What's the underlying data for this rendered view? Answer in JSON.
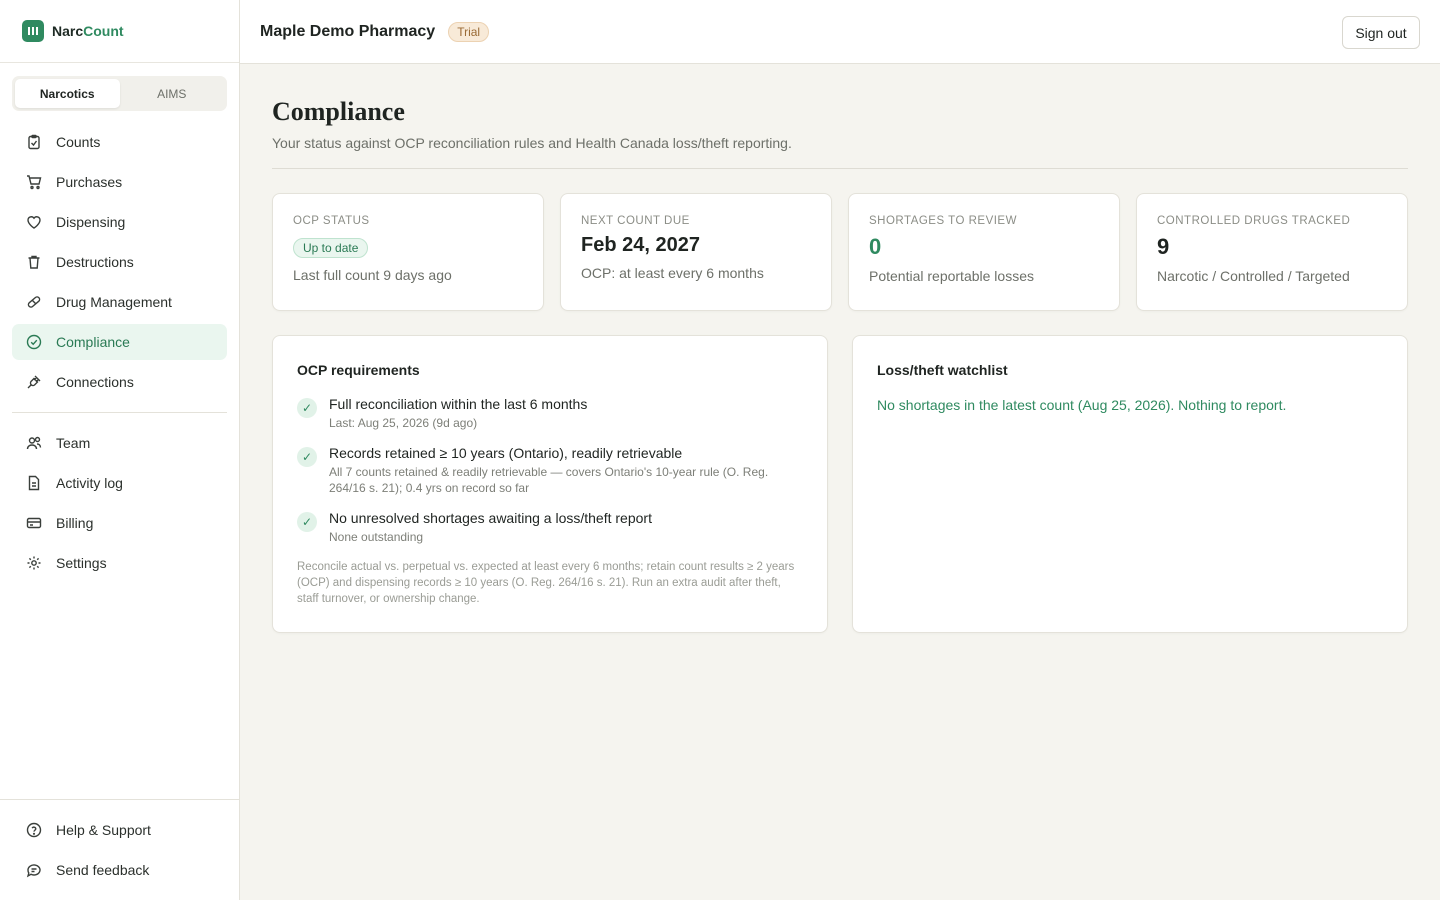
{
  "brand": {
    "name_part1": "Narc",
    "name_part2": "Count"
  },
  "sidebar": {
    "segments": [
      {
        "label": "Narcotics",
        "active": true
      },
      {
        "label": "AIMS",
        "active": false
      }
    ],
    "items": [
      {
        "label": "Counts",
        "icon": "clipboard-check-icon"
      },
      {
        "label": "Purchases",
        "icon": "cart-icon"
      },
      {
        "label": "Dispensing",
        "icon": "heart-icon"
      },
      {
        "label": "Destructions",
        "icon": "trash-icon"
      },
      {
        "label": "Drug Management",
        "icon": "pill-icon"
      },
      {
        "label": "Compliance",
        "icon": "check-circle-icon",
        "active": true
      },
      {
        "label": "Connections",
        "icon": "plug-icon"
      }
    ],
    "admin_items": [
      {
        "label": "Team",
        "icon": "users-icon"
      },
      {
        "label": "Activity log",
        "icon": "document-icon"
      },
      {
        "label": "Billing",
        "icon": "credit-card-icon"
      },
      {
        "label": "Settings",
        "icon": "gear-icon"
      }
    ],
    "footer_items": [
      {
        "label": "Help & Support",
        "icon": "help-circle-icon"
      },
      {
        "label": "Send feedback",
        "icon": "chat-icon"
      }
    ]
  },
  "header": {
    "org_name": "Maple Demo Pharmacy",
    "badge": "Trial",
    "signout_label": "Sign out"
  },
  "page": {
    "title": "Compliance",
    "subtitle": "Your status against OCP reconciliation rules and Health Canada loss/theft reporting."
  },
  "stats": [
    {
      "label": "OCP STATUS",
      "pill": "Up to date",
      "note": "Last full count 9 days ago"
    },
    {
      "label": "NEXT COUNT DUE",
      "value": "Feb 24, 2027",
      "note": "OCP: at least every 6 months"
    },
    {
      "label": "SHORTAGES TO REVIEW",
      "value": "0",
      "note": "Potential reportable losses"
    },
    {
      "label": "CONTROLLED DRUGS TRACKED",
      "value": "9",
      "note": "Narcotic / Controlled / Targeted"
    }
  ],
  "requirements": {
    "title": "OCP requirements",
    "items": [
      {
        "title": "Full reconciliation within the last 6 months",
        "desc": "Last: Aug 25, 2026 (9d ago)"
      },
      {
        "title": "Records retained ≥ 10 years (Ontario), readily retrievable",
        "desc": "All 7 counts retained & readily retrievable — covers Ontario's 10-year rule (O. Reg. 264/16 s. 21); 0.4 yrs on record so far"
      },
      {
        "title": "No unresolved shortages awaiting a loss/theft report",
        "desc": "None outstanding"
      }
    ],
    "footnote": "Reconcile actual vs. perpetual vs. expected at least every 6 months; retain count results ≥ 2 years (OCP) and dispensing records ≥ 10 years (O. Reg. 264/16 s. 21). Run an extra audit after theft, staff turnover, or ownership change."
  },
  "watchlist": {
    "title": "Loss/theft watchlist",
    "message": "No shortages in the latest count (Aug 25, 2026). Nothing to report."
  },
  "colors": {
    "accent": "#2f8a60",
    "active_bg": "#eaf6ef",
    "trial": "#9a6a35"
  }
}
